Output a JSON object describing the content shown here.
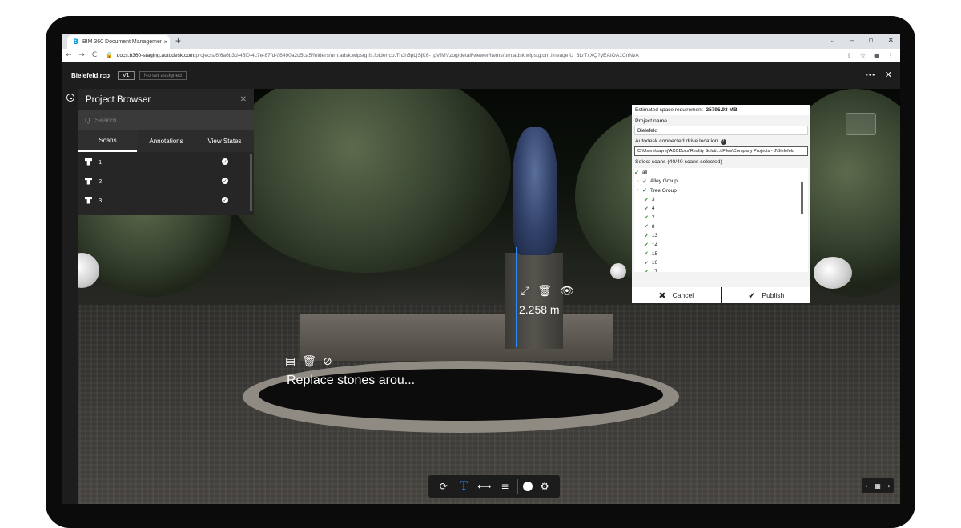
{
  "browser": {
    "tab_title": "BIM 360 Document Management",
    "tab_close": "×",
    "new_tab": "+",
    "favicon": "B",
    "url_host": "docs.b360-staging.autodesk.com",
    "url_path": "/projects/6f6a6b3d-45f0-4c7e-87fd-06490a2d5ca5/folders/urn:adsk.wipstg:fs.folder:co.ThJh5pLjSjK6-_pVfMVzug/detail/viewer/items/urn:adsk.wipstg:dm.lineage:U_6LrTxXQ?yEAIOA1CnNvA",
    "window_controls": [
      "⌄",
      "–",
      "▫",
      "✕"
    ],
    "nav": [
      "←",
      "→",
      "C"
    ],
    "addr_icons": [
      "⇪",
      "☆",
      "●",
      "⋮"
    ]
  },
  "header": {
    "file_name": "Bielefeld.rcp",
    "version": "V1",
    "set_status": "No set assigned",
    "more": "···",
    "close": "✕"
  },
  "project_browser": {
    "title": "Project Browser",
    "close": "✕",
    "search_placeholder": "Search",
    "search_icon": "Q",
    "tabs": [
      "Scans",
      "Annotations",
      "View States"
    ],
    "scans": [
      {
        "label": "1",
        "check": "✓"
      },
      {
        "label": "2",
        "check": "✓"
      },
      {
        "label": "3",
        "check": "✓"
      }
    ]
  },
  "measurement": {
    "value": "2.258 m",
    "tools": [
      "⤢",
      "🗑",
      "👁"
    ]
  },
  "annotation": {
    "text": "Replace stones arou...",
    "tools": [
      "▤",
      "🗑",
      "⊘"
    ]
  },
  "publish_dialog": {
    "space_label": "Estimated space requirement",
    "space_value": "25795.93 MB",
    "project_name_label": "Project name",
    "project_name_value": "Bielefeld",
    "drive_label": "Autodesk connected drive location",
    "drive_path": "C:\\Users\\sayrej\\ACCDocs\\Reality Soluti...t Files\\Company Projects - J\\Bielefeld",
    "select_label": "Select scans (40/40 scans selected)",
    "scan_items": [
      {
        "label": "all",
        "group": false
      },
      {
        "label": "Alley Group",
        "group": true
      },
      {
        "label": "Tree Group",
        "group": true
      },
      {
        "label": "3",
        "group": false
      },
      {
        "label": "4",
        "group": false
      },
      {
        "label": "7",
        "group": false
      },
      {
        "label": "8",
        "group": false
      },
      {
        "label": "13",
        "group": false
      },
      {
        "label": "14",
        "group": false
      },
      {
        "label": "15",
        "group": false
      },
      {
        "label": "16",
        "group": false
      },
      {
        "label": "17",
        "group": false
      }
    ],
    "tick": "✔",
    "caret": "›",
    "cancel_label": "Cancel",
    "cancel_icon": "✖",
    "publish_label": "Publish",
    "publish_icon": "✔"
  },
  "toolbar": {
    "orbit": "⟳",
    "text": "T",
    "measure": "⟷",
    "layers": "≡",
    "settings": "⚙"
  },
  "grid_ctrl": {
    "prev": "‹",
    "grid": "▦",
    "next": "›"
  },
  "colors": {
    "accent": "#2d8cff",
    "dark": "#1d1d1d",
    "panel": "#262626",
    "check_green": "#2e8b2e"
  }
}
